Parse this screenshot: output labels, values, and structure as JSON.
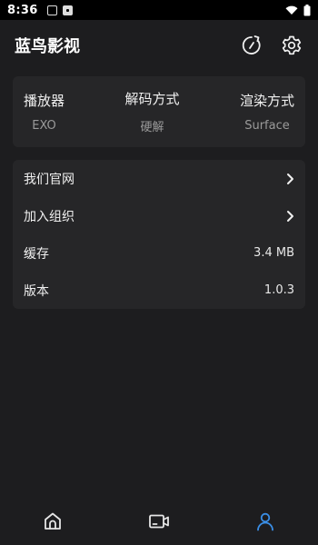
{
  "status_bar": {
    "time": "8:36",
    "icons": [
      "notification-icon",
      "text-notification-icon",
      "wifi-icon",
      "battery-icon"
    ]
  },
  "header": {
    "title": "蓝鸟影视",
    "actions": [
      "refresh-icon",
      "settings-gear-icon"
    ]
  },
  "player_settings": [
    {
      "label": "播放器",
      "value": "EXO"
    },
    {
      "label": "解码方式",
      "value": "硬解"
    },
    {
      "label": "渲染方式",
      "value": "Surface"
    }
  ],
  "menu": {
    "official_site": {
      "label": "我们官网",
      "icon": "chevron-right-icon"
    },
    "join_group": {
      "label": "加入组织",
      "icon": "chevron-right-icon"
    },
    "cache": {
      "label": "缓存",
      "value": "3.4 MB"
    },
    "version": {
      "label": "版本",
      "value": "1.0.3"
    }
  },
  "bottom_nav": {
    "items": [
      {
        "icon": "home-icon",
        "active": false
      },
      {
        "icon": "video-icon",
        "active": false
      },
      {
        "icon": "profile-icon",
        "active": true
      }
    ],
    "active_color": "#3a8ee6",
    "inactive_color": "#e6e6e6"
  }
}
